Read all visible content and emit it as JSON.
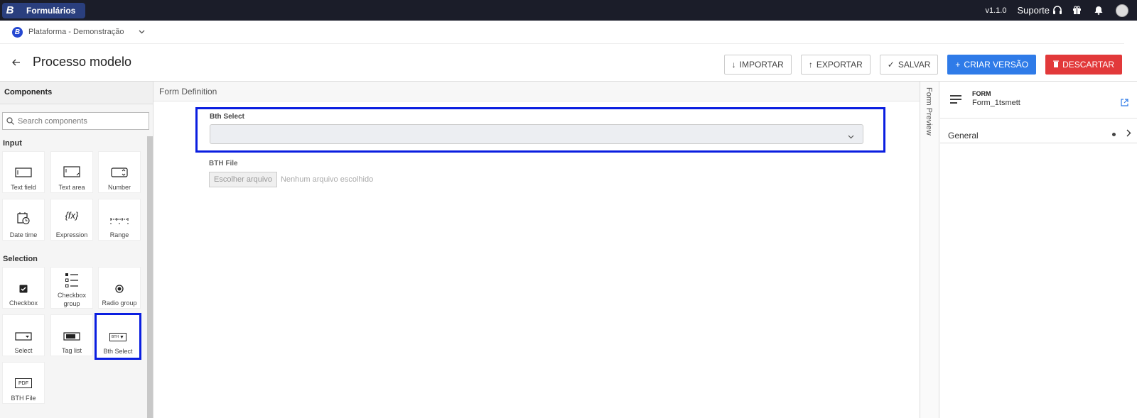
{
  "app": {
    "logo_letter": "B",
    "name": "Formulários",
    "version": "v1.1.0",
    "support_label": "Suporte"
  },
  "platform": {
    "logo_letter": "B",
    "name": "Plataforma - Demonstração"
  },
  "page": {
    "title": "Processo modelo"
  },
  "toolbar": {
    "import_label": "IMPORTAR",
    "export_label": "EXPORTAR",
    "save_label": "SALVAR",
    "create_version_label": "CRIAR VERSÃO",
    "discard_label": "DESCARTAR"
  },
  "palette": {
    "title": "Components",
    "search_placeholder": "Search components",
    "input_group": "Input",
    "selection_group": "Selection",
    "items": {
      "text_field": "Text field",
      "text_area": "Text area",
      "number": "Number",
      "date_time": "Date time",
      "expression": "Expression",
      "range": "Range",
      "checkbox": "Checkbox",
      "checkbox_group": "Checkbox group",
      "radio_group": "Radio group",
      "select": "Select",
      "tag_list": "Tag list",
      "bth_select": "Bth Select",
      "bth_file": "BTH File"
    },
    "icon_labels": {
      "bth": "BTH",
      "pdf": "PDF",
      "fx": "{fx}"
    }
  },
  "canvas": {
    "header": "Form Definition",
    "bth_select_label": "Bth Select",
    "bth_file_label": "BTH File",
    "file_button": "Escolher arquivo",
    "file_status": "Nenhum arquivo escolhido"
  },
  "preview_tab": "Form Preview",
  "properties": {
    "type": "FORM",
    "id": "Form_1tsmett",
    "general_label": "General"
  },
  "colors": {
    "selection": "#0a1ee0",
    "primary": "#2f7be8",
    "danger": "#e2393a",
    "topbar": "#1b1d29"
  }
}
